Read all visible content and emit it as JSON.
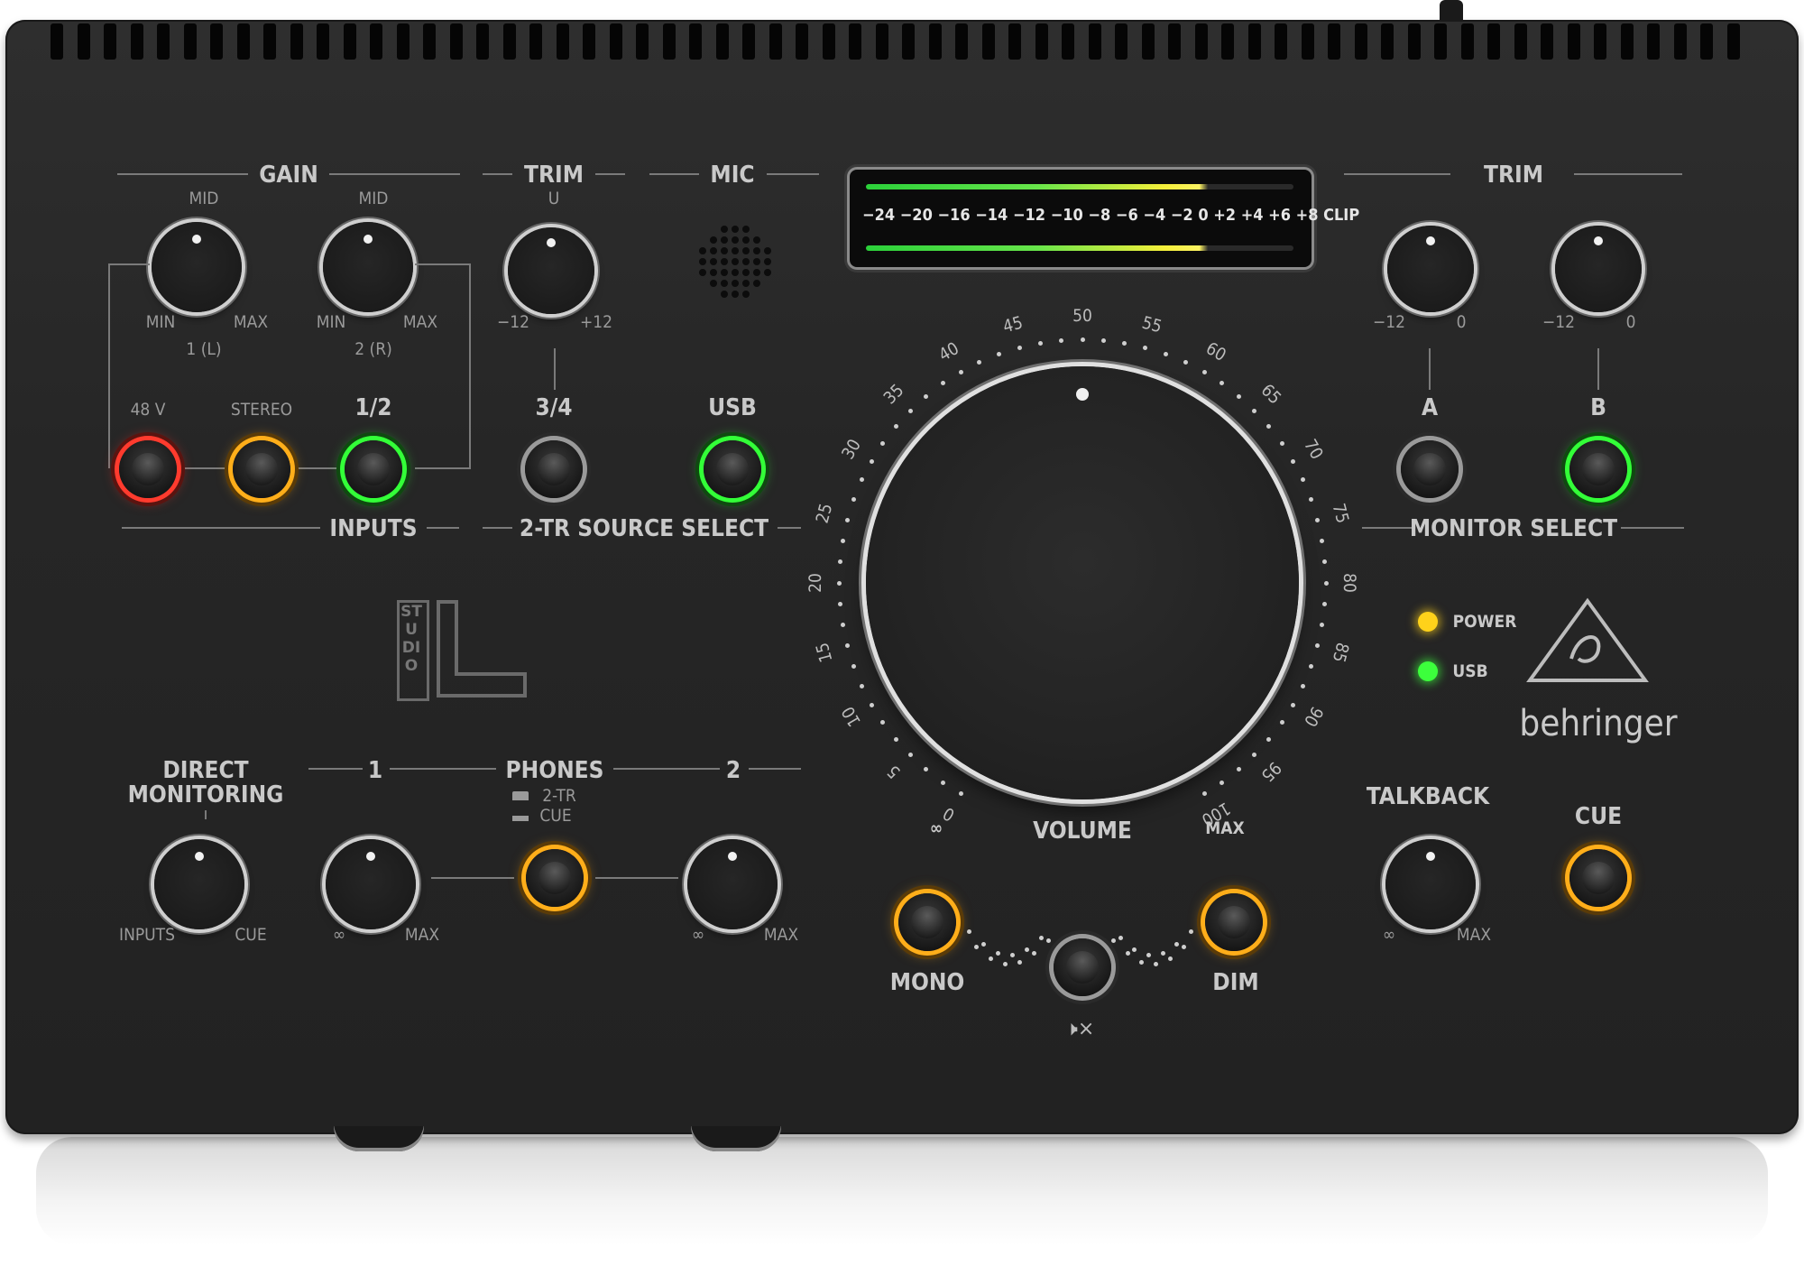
{
  "top_section": {
    "gain": {
      "title": "GAIN",
      "knob1_top": "MID",
      "knob1_min": "MIN",
      "knob1_max": "MAX",
      "knob1_name": "1 (L)",
      "knob2_top": "MID",
      "knob2_min": "MIN",
      "knob2_max": "MAX",
      "knob2_name": "2 (R)"
    },
    "trim_left": {
      "title": "TRIM",
      "top": "U",
      "min": "−12",
      "max": "+12"
    },
    "mic": {
      "title": "MIC"
    },
    "inputs": {
      "title": "INPUTS",
      "btn_48v": "48 V",
      "btn_stereo": "STEREO",
      "btn_12": "1/2"
    },
    "source_select": {
      "title": "2-TR SOURCE SELECT",
      "btn_34": "3/4",
      "btn_usb": "USB"
    },
    "meter": {
      "scale": "−24 −20 −16 −14 −12 −10 −8 −6 −4 −2  0 +2 +4 +6 +8 CLIP"
    },
    "trim_right": {
      "title": "TRIM",
      "a_min": "−12",
      "a_max": "0",
      "b_min": "−12",
      "b_max": "0"
    },
    "monitor_select": {
      "title": "MONITOR SELECT",
      "a": "A",
      "b": "B"
    }
  },
  "volume": {
    "label": "VOLUME",
    "min": "∞",
    "max": "MAX",
    "scale": [
      "0",
      "5",
      "10",
      "15",
      "20",
      "25",
      "30",
      "35",
      "40",
      "45",
      "50",
      "55",
      "60",
      "65",
      "70",
      "75",
      "80",
      "85",
      "90",
      "95",
      "100"
    ]
  },
  "status": {
    "power": "POWER",
    "usb": "USB",
    "power_color": "#ffd21a",
    "usb_color": "#3cff3c"
  },
  "brand": {
    "name": "behringer",
    "model_vertical": "STUDIO"
  },
  "bottom_section": {
    "direct_monitoring": {
      "title_line1": "DIRECT",
      "title_line2": "MONITORING",
      "min": "INPUTS",
      "max": "CUE"
    },
    "phones": {
      "title": "PHONES",
      "ch1": "1",
      "ch2": "2",
      "src1": "2-TR",
      "src2": "CUE",
      "p1_min": "∞",
      "p1_max": "MAX",
      "p2_min": "∞",
      "p2_max": "MAX"
    },
    "mono": "MONO",
    "dim": "DIM",
    "mute_icon": "speaker-mute-icon",
    "talkback": {
      "title": "TALKBACK",
      "min": "∞",
      "max": "MAX"
    },
    "cue": "CUE"
  },
  "colors": {
    "red": "#ff3b2e",
    "orange": "#ffae1a",
    "green": "#33ff38",
    "panel": "#262626"
  }
}
